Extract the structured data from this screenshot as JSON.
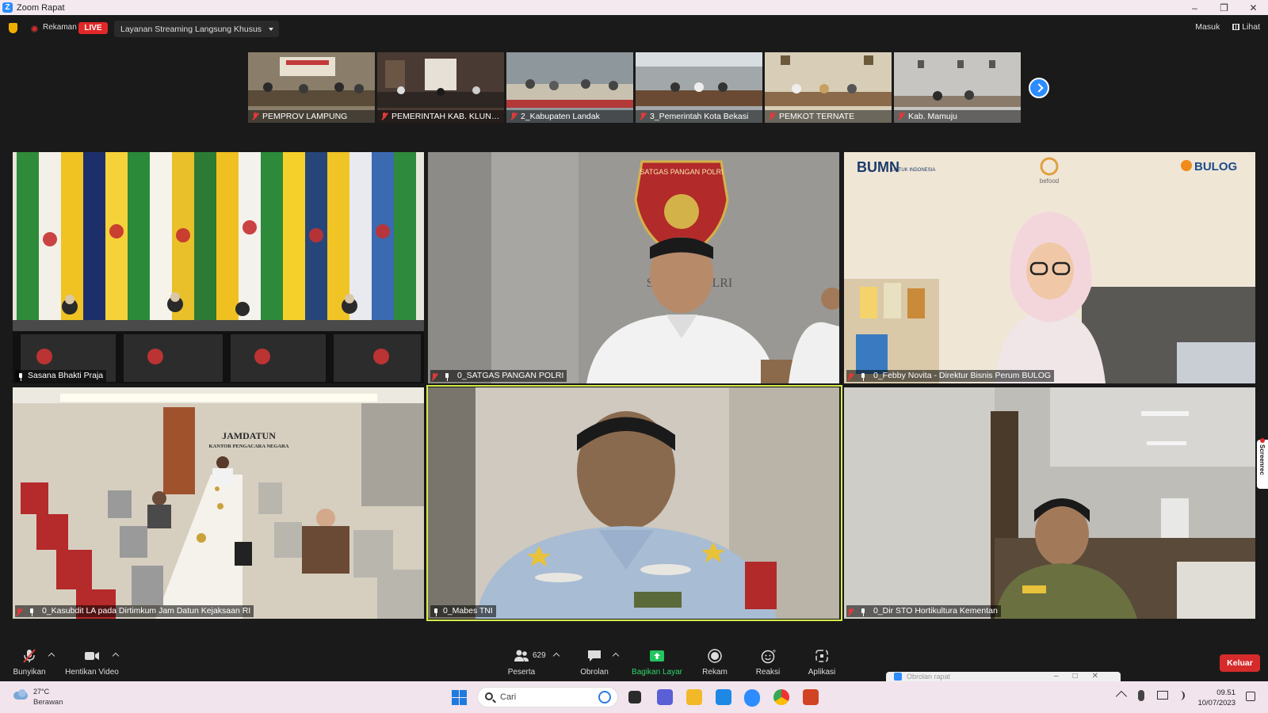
{
  "window": {
    "title": "Zoom Rapat",
    "controls": [
      "–",
      "❐",
      "✕"
    ]
  },
  "status": {
    "recording_label": "Rekaman",
    "live_badge": "LIVE",
    "streaming_dropdown": "Layanan Streaming Langsung Khusus",
    "sign_in": "Masuk",
    "view": "Lihat"
  },
  "filmstrip": [
    {
      "name": "PEMPROV LAMPUNG",
      "bg": "#8a7e6a"
    },
    {
      "name": "PEMERINTAH KAB. KLUNG...",
      "bg": "#5a4a42"
    },
    {
      "name": "2_Kabupaten Landak",
      "bg": "#7d8a94"
    },
    {
      "name": "3_Pemerintah Kota Bekasi",
      "bg": "#a0a6a8"
    },
    {
      "name": "PEMKOT TERNATE",
      "bg": "#b9ab8e"
    },
    {
      "name": "Kab. Mamuju",
      "bg": "#c3c2c0"
    }
  ],
  "tiles": [
    {
      "name": "Sasana Bhakti Praja",
      "muted": false
    },
    {
      "name": "0_SATGAS PANGAN POLRI",
      "muted": true
    },
    {
      "name": "0_Febby Novita - Direktur Bisnis Perum BULOG",
      "muted": true
    },
    {
      "name": "0_Kasubdit LA pada Dirtimkum Jam Datun Kejaksaan RI",
      "muted": true
    },
    {
      "name": "0_Mabes TNI",
      "muted": false
    },
    {
      "name": "0_Dir STO Hortikultura Kementan",
      "muted": true
    }
  ],
  "scene_text": {
    "bumn": "BUMN",
    "bumn_sub": "UNTUK INDONESIA",
    "befood": "befood",
    "bulog": "BULOG",
    "satgas_emblem": "SATGAS PANGAN POLRI",
    "wall_text": "SA   GAN POLRI",
    "jamdatun": "JAMDATUN",
    "jamdatun_sub": "KANTOR PENGACARA NEGARA"
  },
  "toolbar": {
    "unmute": "Bunyikan",
    "stop_video": "Hentikan Video",
    "participants_count": "629",
    "participants": "Peserta",
    "chat": "Obrolan",
    "share_screen": "Bagikan Layar",
    "record": "Rekam",
    "reactions": "Reaksi",
    "apps": "Aplikasi",
    "leave": "Keluar",
    "chat_popup_title": "Obrolan rapat"
  },
  "screenrec": "Screenrec",
  "taskbar": {
    "temperature": "27°C",
    "condition": "Berawan",
    "search_placeholder": "Cari",
    "time": "09.51",
    "date": "10/07/2023"
  },
  "colors": {
    "zoom_blue": "#2d8cff",
    "live_red": "#e02828",
    "active_speaker": "#d7ec4a",
    "share_green": "#22c55e",
    "leave_red": "#d62b2b"
  }
}
